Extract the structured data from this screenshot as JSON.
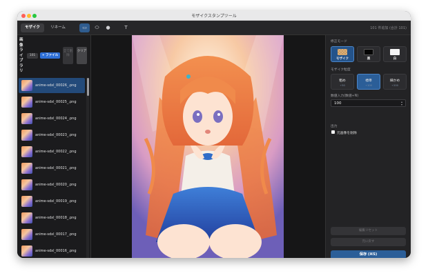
{
  "window": {
    "title": "モザイクスタンプツール"
  },
  "toolbar": {
    "tabs": [
      {
        "label": "モザイク",
        "active": true
      },
      {
        "label": "リネーム",
        "active": false
      }
    ],
    "tools": [
      {
        "name": "rectangle-tool",
        "icon": "rectangle-icon",
        "glyph": "▭",
        "active": true
      },
      {
        "name": "ellipse-tool",
        "icon": "ellipse-icon",
        "glyph": "⬭",
        "active": false
      },
      {
        "name": "circle-tool",
        "icon": "circle-icon",
        "glyph": "●",
        "active": false
      },
      {
        "name": "text-tool",
        "icon": "text-icon",
        "glyph": "T",
        "active": false
      }
    ],
    "status": "101 件追加 (合計 101)"
  },
  "sidebar": {
    "title": "画像ライブラリ",
    "count": "101",
    "add_file_label": "+ ファイル",
    "delete_all_label": "全て削除",
    "clear_label": "クリア",
    "files": [
      {
        "name": "anime-sdxl_00026_.png",
        "selected": true
      },
      {
        "name": "anime-sdxl_00025_.png",
        "selected": false
      },
      {
        "name": "anime-sdxl_00024_.png",
        "selected": false
      },
      {
        "name": "anime-sdxl_00023_.png",
        "selected": false
      },
      {
        "name": "anime-sdxl_00022_.png",
        "selected": false
      },
      {
        "name": "anime-sdxl_00021_.png",
        "selected": false
      },
      {
        "name": "anime-sdxl_00020_.png",
        "selected": false
      },
      {
        "name": "anime-sdxl_00019_.png",
        "selected": false
      },
      {
        "name": "anime-sdxl_00018_.png",
        "selected": false
      },
      {
        "name": "anime-sdxl_00017_.png",
        "selected": false
      },
      {
        "name": "anime-sdxl_00016_.png",
        "selected": false
      }
    ]
  },
  "panel": {
    "fill_mode_label": "修正モード",
    "fill_modes": [
      {
        "label": "モザイク",
        "swatch": "mosaic",
        "active": true
      },
      {
        "label": "黒",
        "swatch": "black",
        "active": false
      },
      {
        "label": "白",
        "swatch": "white",
        "active": false
      }
    ],
    "strength_label": "モザイク粒度",
    "strengths": [
      {
        "label": "粗め",
        "value": "÷50",
        "active": false
      },
      {
        "label": "標準",
        "value": "÷100",
        "active": true
      },
      {
        "label": "細かめ",
        "value": "÷200",
        "active": false
      }
    ],
    "custom_label": "数値入力(数値÷N)",
    "custom_value": "100",
    "output_label": "出力",
    "delete_original_label": "元画像を削除",
    "reset_label": "編集リセット",
    "undo_label": "元に戻す",
    "save_label": "保存 (⌘S)"
  },
  "colors": {
    "accent": "#2b5e98",
    "window_bg": "#1e1e20",
    "file_button": "#2e6fd6"
  }
}
